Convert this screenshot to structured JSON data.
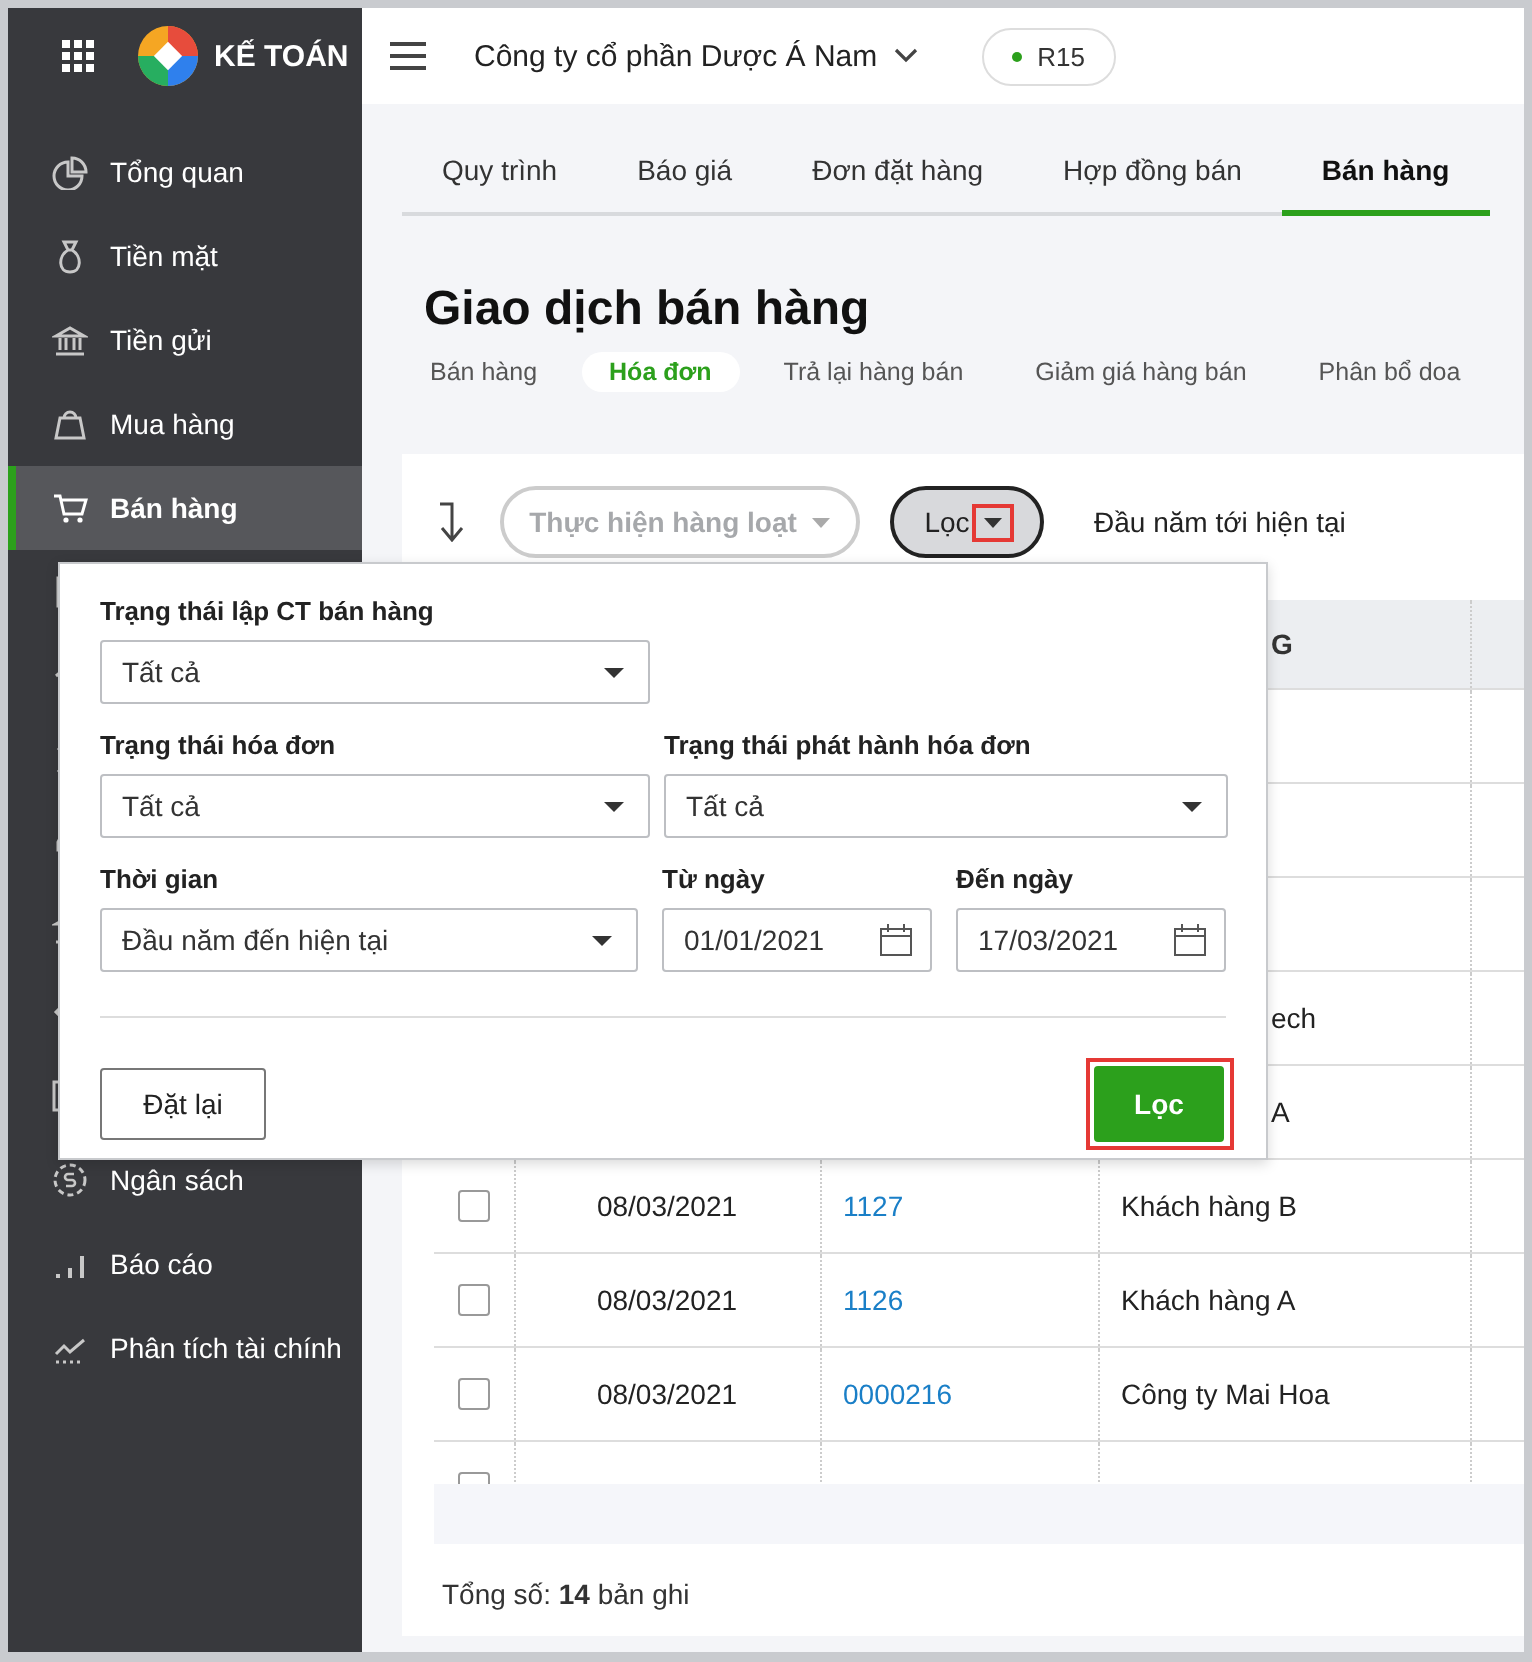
{
  "app": {
    "logo": "KẾ TOÁN"
  },
  "sidebar": {
    "items": [
      {
        "label": "Tổng quan",
        "selected": false
      },
      {
        "label": "Tiền mặt",
        "selected": false
      },
      {
        "label": "Tiền gửi",
        "selected": false
      },
      {
        "label": "Mua hàng",
        "selected": false
      },
      {
        "label": "Bán hàng",
        "selected": true
      },
      {
        "selected": false
      },
      {
        "selected": false
      },
      {
        "selected": false
      },
      {
        "selected": false
      },
      {
        "selected": false
      },
      {
        "selected": false
      },
      {
        "selected": false
      },
      {
        "label": "Ngân sách",
        "selected": false
      },
      {
        "label": "Báo cáo",
        "selected": false
      },
      {
        "label": "Phân tích tài chính",
        "selected": false
      }
    ]
  },
  "topbar": {
    "company": "Công ty cổ phần Dược Á Nam",
    "badge": "R15"
  },
  "tabs": [
    {
      "label": "Quy trình",
      "selected": false
    },
    {
      "label": "Báo giá",
      "selected": false
    },
    {
      "label": "Đơn đặt hàng",
      "selected": false
    },
    {
      "label": "Hợp đồng bán",
      "selected": false
    },
    {
      "label": "Bán hàng",
      "selected": true
    }
  ],
  "title": "Giao dịch bán hàng",
  "subtabs": [
    {
      "label": "Bán hàng",
      "selected": false
    },
    {
      "label": "Hóa đơn",
      "selected": true
    },
    {
      "label": "Trả lại hàng bán",
      "selected": false
    },
    {
      "label": "Giảm giá hàng bán",
      "selected": false
    },
    {
      "label": "Phân bổ doa",
      "selected": false
    }
  ],
  "toolbar": {
    "bulk_action": {
      "label": "Thực hiện hàng loạt",
      "disabled": true
    },
    "filter_button": {
      "label": "Lọc",
      "highlighted": true
    },
    "period": "Đầu năm tới hiện tại"
  },
  "table": {
    "header": {
      "covered": true,
      "customer": "G"
    },
    "rows": [
      {},
      {},
      {},
      {
        "covered": true,
        "customer": "ech"
      },
      {
        "covered": true,
        "customer": "A"
      },
      {
        "checked": false,
        "date": "08/03/2021",
        "number": "1127",
        "customer": "Khách hàng B"
      },
      {
        "checked": false,
        "date": "08/03/2021",
        "number": "1126",
        "customer": "Khách hàng A"
      },
      {
        "checked": false,
        "date": "08/03/2021",
        "number": "0000216",
        "customer": "Công ty Mai Hoa"
      },
      {
        "checked": false
      }
    ],
    "total": "Tổng số: **14** bản ghi"
  },
  "filter_popup": {
    "rows": [
      [
        {
          "kind": "select",
          "label": "Trạng thái lập CT bán hàng",
          "value": "Tất cả"
        }
      ],
      [
        {
          "kind": "select",
          "label": "Trạng thái hóa đơn",
          "value": "Tất cả"
        },
        {
          "kind": "select",
          "label": "Trạng thái phát hành hóa đơn",
          "value": "Tất cả"
        }
      ],
      [
        {
          "kind": "select",
          "label": "Thời gian",
          "value": "Đầu năm đến hiện tại"
        },
        {
          "kind": "date",
          "label": "Từ ngày",
          "value": "01/01/2021"
        },
        {
          "kind": "date",
          "label": "Đến ngày",
          "value": "17/03/2021"
        }
      ]
    ],
    "reset": "Đặt lại",
    "submit": {
      "label": "Lọc",
      "highlighted": true
    }
  }
}
